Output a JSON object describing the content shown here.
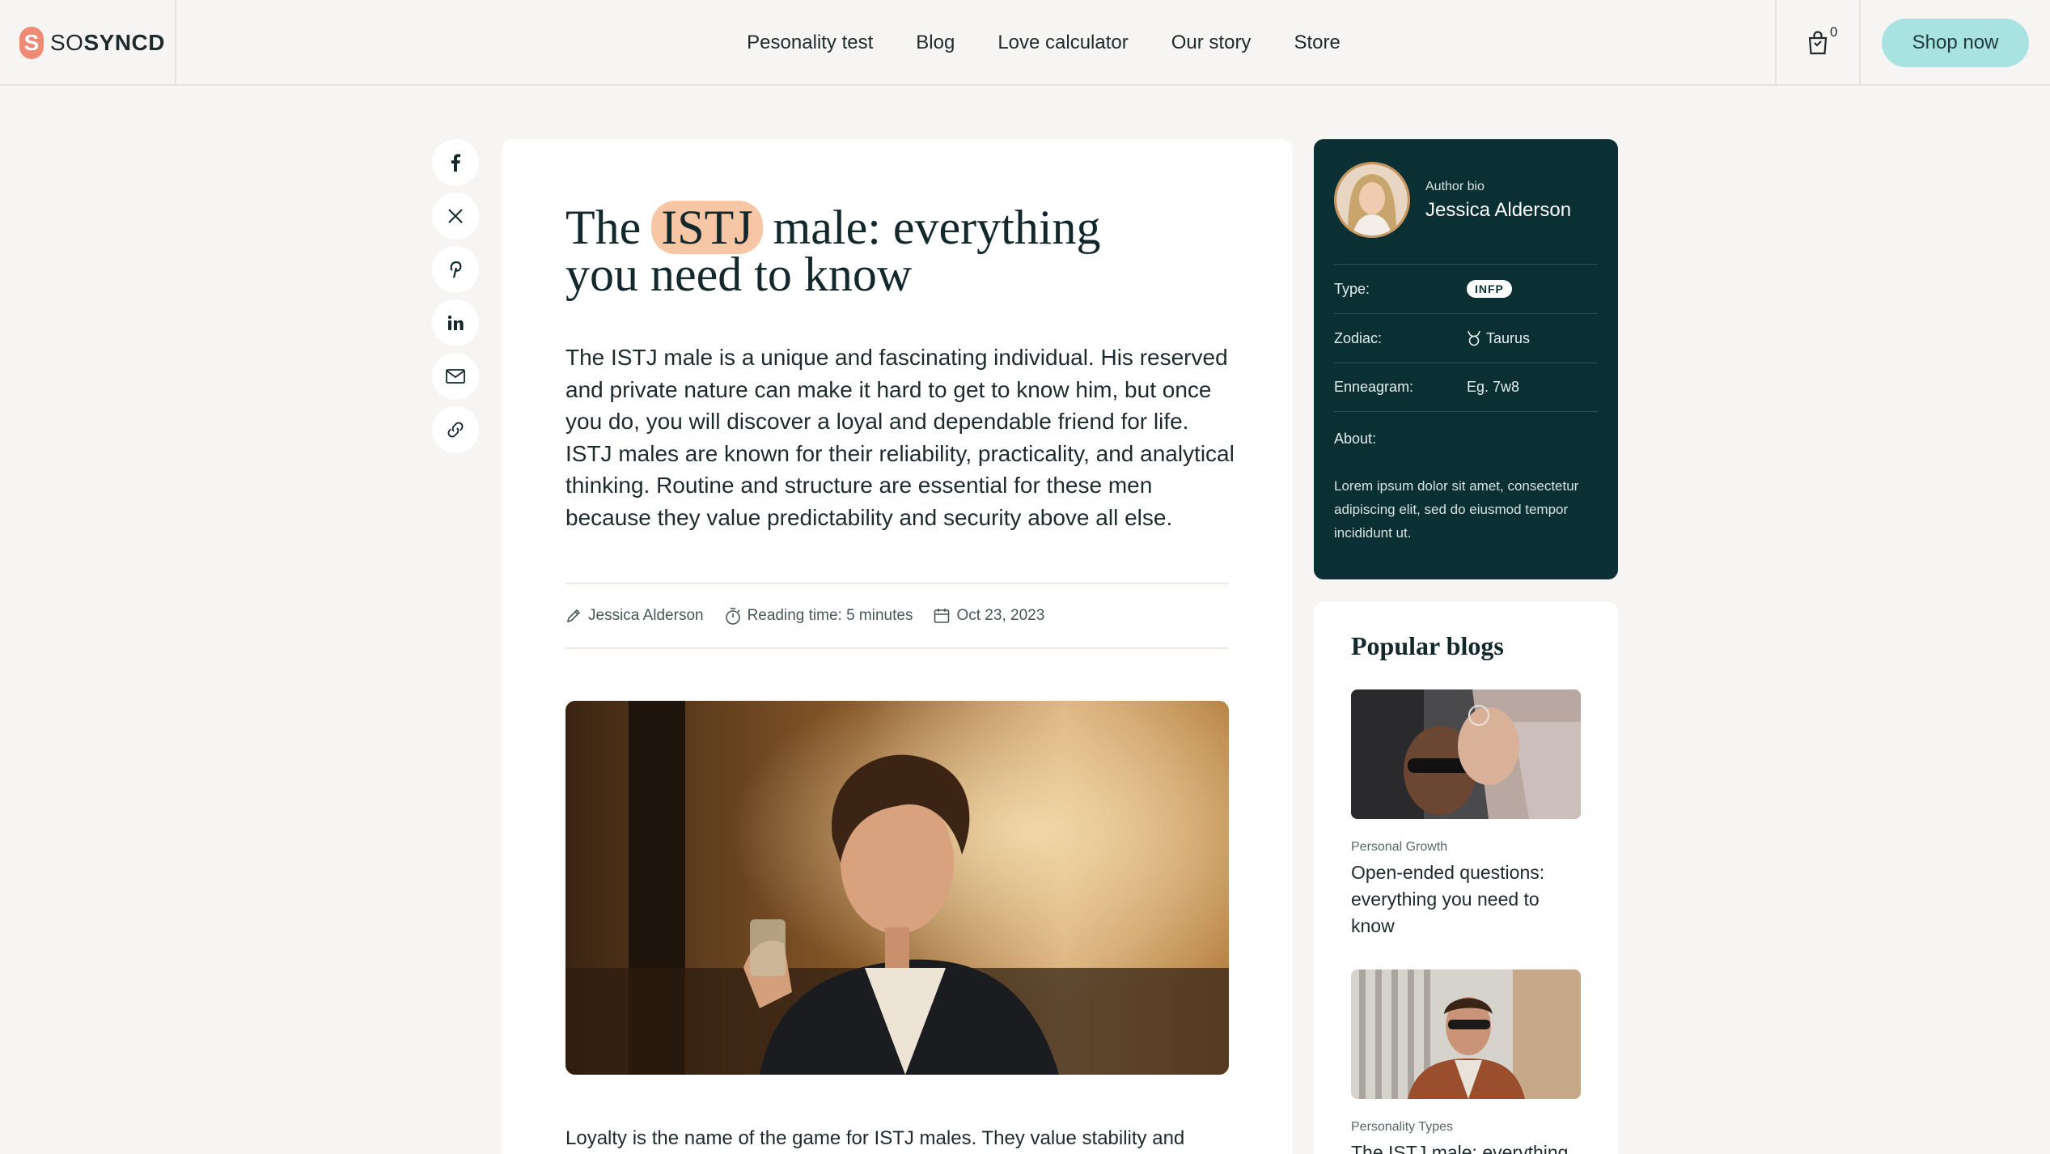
{
  "brand": {
    "mark": "S",
    "name_prefix": "SO",
    "name_suffix": "SYNCD",
    "accent": "#ef8a74"
  },
  "nav": {
    "items": [
      {
        "label": "Pesonality test"
      },
      {
        "label": "Blog"
      },
      {
        "label": "Love calculator"
      },
      {
        "label": "Our story"
      },
      {
        "label": "Store"
      }
    ]
  },
  "cart": {
    "count": "0",
    "icon": "shopping-bag-icon"
  },
  "header_cta": {
    "label": "Shop now",
    "color": "#a8e2e1"
  },
  "share": {
    "icons": [
      "facebook-icon",
      "x-icon",
      "pinterest-icon",
      "linkedin-icon",
      "mail-icon",
      "link-icon"
    ]
  },
  "article": {
    "title_before": "The",
    "title_highlight": "ISTJ",
    "title_after": "male: everything you need to know",
    "lead": "The ISTJ male is a unique and fascinating individual. His reserved and private nature can make it hard to get to know him, but once you do, you will discover a loyal and dependable friend for life. ISTJ males are known for their reliability, practicality, and analytical thinking. Routine and structure are essential for these men because they value predictability and security above all else.",
    "meta": {
      "author": "Jessica Alderson",
      "reading_time": "Reading time: 5 minutes",
      "date": "Oct 23, 2023"
    },
    "body_start": "Loyalty is the name of the game for ISTJ males. They value stability and"
  },
  "author_bio": {
    "label": "Author bio",
    "name": "Jessica Alderson",
    "type_label": "Type:",
    "type_value": "INFP",
    "zodiac_label": "Zodiac:",
    "zodiac_value": "Taurus",
    "enneagram_label": "Enneagram:",
    "enneagram_value": "Eg. 7w8",
    "about_label": "About:",
    "about_text": "Lorem ipsum dolor sit amet, consectetur adipiscing elit, sed do eiusmod tempor incididunt ut.",
    "bg_color": "#0b3033"
  },
  "popular": {
    "title": "Popular blogs",
    "items": [
      {
        "category": "Personal Growth",
        "title": "Open-ended questions: everything you need to know"
      },
      {
        "category": "Personality Types",
        "title": "The ISTJ male: everything"
      }
    ]
  }
}
